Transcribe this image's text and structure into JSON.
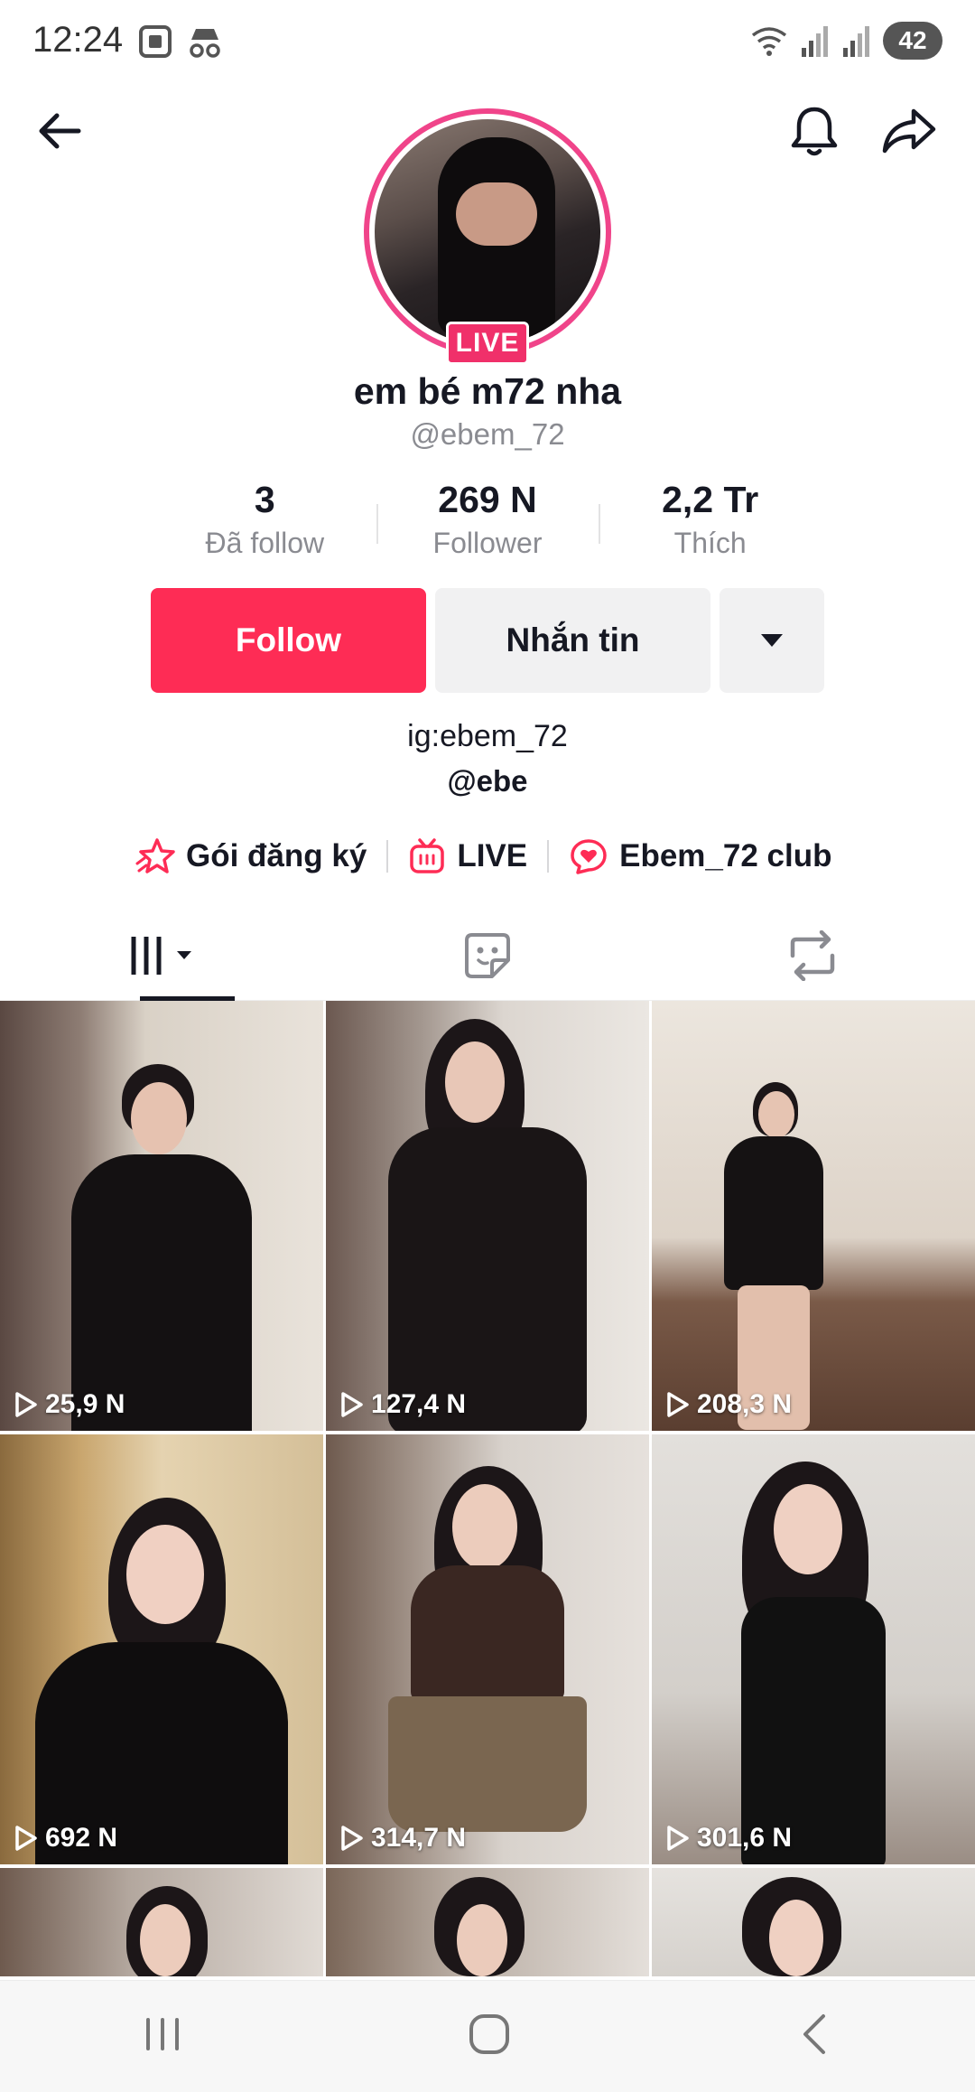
{
  "status": {
    "time": "12:24",
    "battery": "42"
  },
  "profile": {
    "live_label": "LIVE",
    "display_name": "em bé m72 nha",
    "username": "@ebem_72"
  },
  "stats": [
    {
      "value": "3",
      "label": "Đã follow"
    },
    {
      "value": "269 N",
      "label": "Follower"
    },
    {
      "value": "2,2 Tr",
      "label": "Thích"
    }
  ],
  "actions": {
    "follow": "Follow",
    "message": "Nhắn tin"
  },
  "bio": {
    "line1": "ig:ebem_72",
    "line2": "@ebe"
  },
  "links": [
    {
      "label": "Gói đăng ký",
      "icon": "subscription-star-icon"
    },
    {
      "label": "LIVE",
      "icon": "live-tv-icon"
    },
    {
      "label": "Ebem_72 club",
      "icon": "heart-chat-icon"
    }
  ],
  "tabs": [
    "videos-grid-icon",
    "favorites-sticker-icon",
    "reposts-icon"
  ],
  "videos": [
    {
      "views": "25,9 N"
    },
    {
      "views": "127,4 N"
    },
    {
      "views": "208,3 N"
    },
    {
      "views": "692 N"
    },
    {
      "views": "314,7 N"
    },
    {
      "views": "301,6 N"
    }
  ],
  "colors": {
    "accent": "#fe2c55",
    "live": "#f0306a",
    "avatar_ring": "#f0448a"
  }
}
